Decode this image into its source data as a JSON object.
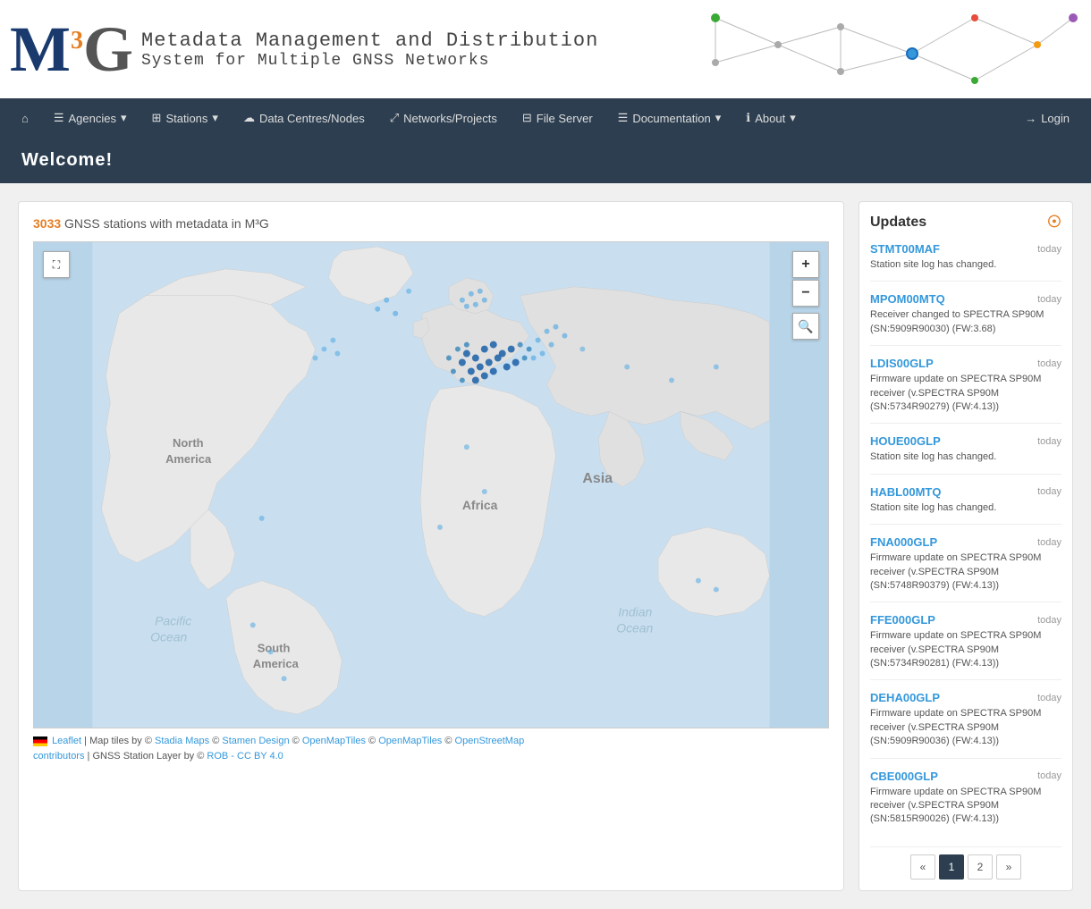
{
  "header": {
    "logo_m": "M",
    "logo_superscript": "3",
    "logo_g": "G",
    "title_line1": "Metadata Management and Distribution",
    "title_line2": "System for Multiple GNSS Networks"
  },
  "navbar": {
    "home_icon": "⌂",
    "items": [
      {
        "id": "agencies",
        "label": "Agencies",
        "icon": "☰",
        "has_dropdown": true
      },
      {
        "id": "stations",
        "label": "Stations",
        "icon": "⊞",
        "has_dropdown": true
      },
      {
        "id": "data-centres",
        "label": "Data Centres/Nodes",
        "icon": "☁",
        "has_dropdown": false
      },
      {
        "id": "networks",
        "label": "Networks/Projects",
        "icon": "⤢",
        "has_dropdown": false
      },
      {
        "id": "file-server",
        "label": "File Server",
        "icon": "⊟",
        "has_dropdown": false
      },
      {
        "id": "documentation",
        "label": "Documentation",
        "icon": "☰",
        "has_dropdown": true
      },
      {
        "id": "about",
        "label": "About",
        "icon": "ℹ",
        "has_dropdown": true
      }
    ],
    "login_label": "Login",
    "login_icon": "→"
  },
  "welcome": {
    "text": "Welcome!"
  },
  "map": {
    "station_count": "3033",
    "description": "GNSS stations with metadata in M³G",
    "zoom_in": "+",
    "zoom_out": "−",
    "search_icon": "🔍",
    "footer": {
      "leaflet_label": "Leaflet",
      "tiles_text": "| Map tiles by © Stadia Maps © Stamen Design © OpenMapTiles © OpenMapTiles © OpenStreetMap contributors",
      "gnss_layer_text": "| GNSS Station Layer by ©",
      "rob_link": "ROB - CC BY 4.0"
    }
  },
  "updates": {
    "title": "Updates",
    "items": [
      {
        "station": "STMT00MAF",
        "date": "today",
        "description": "Station site log has changed."
      },
      {
        "station": "MPOM00MTQ",
        "date": "today",
        "description": "Receiver changed to SPECTRA SP90M (SN:5909R90030) (FW:3.68)"
      },
      {
        "station": "LDIS00GLP",
        "date": "today",
        "description": "Firmware update on SPECTRA SP90M receiver (v.SPECTRA SP90M (SN:5734R90279) (FW:4.13))"
      },
      {
        "station": "HOUE00GLP",
        "date": "today",
        "description": "Station site log has changed."
      },
      {
        "station": "HABL00MTQ",
        "date": "today",
        "description": "Station site log has changed."
      },
      {
        "station": "FNA000GLP",
        "date": "today",
        "description": "Firmware update on SPECTRA SP90M receiver (v.SPECTRA SP90M (SN:5748R90379) (FW:4.13))"
      },
      {
        "station": "FFE000GLP",
        "date": "today",
        "description": "Firmware update on SPECTRA SP90M receiver (v.SPECTRA SP90M (SN:5734R90281) (FW:4.13))"
      },
      {
        "station": "DEHA00GLP",
        "date": "today",
        "description": "Firmware update on SPECTRA SP90M receiver (v.SPECTRA SP90M (SN:5909R90036) (FW:4.13))"
      },
      {
        "station": "CBE000GLP",
        "date": "today",
        "description": "Firmware update on SPECTRA SP90M receiver (v.SPECTRA SP90M (SN:5815R90026) (FW:4.13))"
      }
    ],
    "pagination": {
      "prev": "«",
      "page1": "1",
      "page2": "2",
      "next": "»"
    }
  }
}
